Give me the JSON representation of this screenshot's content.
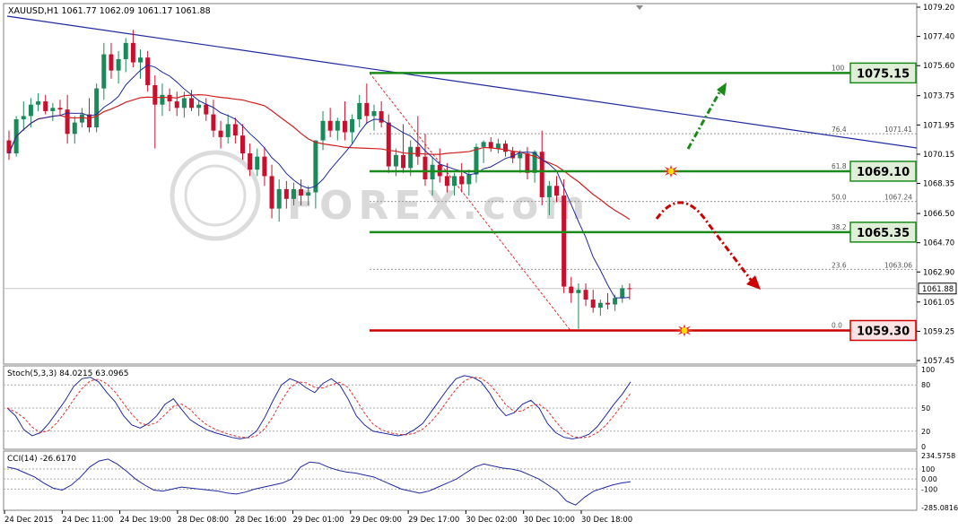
{
  "symbol_header": "XAUUSD,H1  1061.77 1062.09 1061.17 1061.88",
  "watermark": "FOREX.com",
  "price_axis": {
    "ticks": [
      "1079.20",
      "1077.40",
      "1075.60",
      "1073.75",
      "1071.95",
      "1070.15",
      "1068.35",
      "1066.50",
      "1064.70",
      "1062.90",
      "1061.05",
      "1059.25",
      "1057.45"
    ],
    "current_price": "1061.88",
    "range": [
      1057.45,
      1079.2
    ]
  },
  "time_axis": [
    "24 Dec 2015",
    "24 Dec 11:00",
    "24 Dec 19:00",
    "28 Dec 08:00",
    "28 Dec 16:00",
    "29 Dec 01:00",
    "29 Dec 09:00",
    "29 Dec 17:00",
    "30 Dec 02:00",
    "30 Dec 10:00",
    "30 Dec 18:00"
  ],
  "levels": [
    {
      "label": "1075.15",
      "price": 1075.15,
      "color": "#1a8a1a",
      "fib": "100"
    },
    {
      "label": "1069.10",
      "price": 1069.1,
      "color": "#1a8a1a",
      "fib": "61.8"
    },
    {
      "label": "1065.35",
      "price": 1065.35,
      "color": "#1a8a1a",
      "fib": "38.2"
    },
    {
      "label": "1059.30",
      "price": 1059.3,
      "color": "#cc0000",
      "fib": "0.0"
    }
  ],
  "fib_dotted": [
    {
      "fib": "76.4",
      "price": 1071.41,
      "price_label": "1071.41"
    },
    {
      "fib": "50.0",
      "price": 1067.24,
      "price_label": "1067.24"
    },
    {
      "fib": "23.6",
      "price": 1063.06,
      "price_label": "1063.06"
    }
  ],
  "stoch": {
    "label": "Stoch(5,3,3) 84.0215 63.0965",
    "ticks": [
      "100",
      "80",
      "50",
      "20",
      "0"
    ]
  },
  "cci": {
    "label": "CCI(14) -26.6170",
    "ticks": [
      "234.5758",
      "0.00",
      "-100",
      "-285.0816"
    ],
    "extra_tick": "100"
  },
  "colors": {
    "bull": "#1a8a5a",
    "bear": "#c8102e",
    "trend": "#1f2a9e",
    "ma_red": "#d02020",
    "ma_blue": "#1f2a9e",
    "up_arrow": "#1a8a1a",
    "down_arrow": "#cc0000"
  },
  "chart_data": {
    "type": "candlestick",
    "title": "XAUUSD,H1",
    "ylim": [
      1057.45,
      1079.2
    ],
    "candles": [
      [
        1071.0,
        1071.6,
        1069.8,
        1070.2
      ],
      [
        1070.2,
        1072.5,
        1070.0,
        1072.3
      ],
      [
        1072.3,
        1073.4,
        1071.6,
        1072.5
      ],
      [
        1072.5,
        1073.6,
        1071.8,
        1073.2
      ],
      [
        1073.2,
        1073.9,
        1072.8,
        1073.4
      ],
      [
        1073.4,
        1073.8,
        1072.6,
        1072.8
      ],
      [
        1072.8,
        1073.3,
        1072.2,
        1073.0
      ],
      [
        1073.0,
        1073.5,
        1072.5,
        1072.9
      ],
      [
        1072.9,
        1073.8,
        1070.8,
        1071.4
      ],
      [
        1071.4,
        1072.5,
        1070.8,
        1072.1
      ],
      [
        1072.1,
        1073.0,
        1071.8,
        1072.6
      ],
      [
        1072.6,
        1073.6,
        1071.5,
        1071.8
      ],
      [
        1071.8,
        1074.5,
        1071.5,
        1074.2
      ],
      [
        1074.2,
        1077.0,
        1073.5,
        1076.3
      ],
      [
        1076.3,
        1077.0,
        1074.8,
        1075.3
      ],
      [
        1075.3,
        1076.5,
        1074.5,
        1076.0
      ],
      [
        1076.0,
        1077.3,
        1075.2,
        1077.0
      ],
      [
        1077.0,
        1077.8,
        1075.5,
        1075.8
      ],
      [
        1075.8,
        1076.6,
        1074.8,
        1076.1
      ],
      [
        1076.1,
        1076.5,
        1074.0,
        1074.4
      ],
      [
        1074.4,
        1075.0,
        1070.5,
        1073.2
      ],
      [
        1073.2,
        1074.5,
        1072.5,
        1073.8
      ],
      [
        1073.8,
        1074.2,
        1072.8,
        1073.4
      ],
      [
        1073.4,
        1074.0,
        1072.5,
        1073.0
      ],
      [
        1073.0,
        1074.0,
        1072.4,
        1073.6
      ],
      [
        1073.6,
        1074.1,
        1072.8,
        1073.0
      ],
      [
        1073.0,
        1073.5,
        1072.5,
        1073.2
      ],
      [
        1073.2,
        1073.6,
        1072.2,
        1072.6
      ],
      [
        1072.6,
        1073.5,
        1071.2,
        1071.6
      ],
      [
        1071.6,
        1072.2,
        1070.5,
        1071.2
      ],
      [
        1071.2,
        1072.6,
        1070.8,
        1072.0
      ],
      [
        1072.0,
        1072.4,
        1070.8,
        1071.3
      ],
      [
        1071.3,
        1072.0,
        1069.8,
        1070.2
      ],
      [
        1070.2,
        1070.8,
        1068.8,
        1069.2
      ],
      [
        1069.2,
        1070.5,
        1068.8,
        1070.0
      ],
      [
        1070.0,
        1070.6,
        1068.2,
        1068.8
      ],
      [
        1068.8,
        1069.5,
        1066.2,
        1066.8
      ],
      [
        1066.8,
        1068.6,
        1066.0,
        1068.0
      ],
      [
        1068.0,
        1068.5,
        1066.8,
        1067.4
      ],
      [
        1067.4,
        1068.4,
        1067.0,
        1068.0
      ],
      [
        1068.0,
        1068.6,
        1067.0,
        1067.6
      ],
      [
        1067.6,
        1068.2,
        1067.0,
        1067.8
      ],
      [
        1067.8,
        1070.0,
        1066.8,
        1071.0
      ],
      [
        1071.0,
        1072.8,
        1070.4,
        1072.2
      ],
      [
        1072.2,
        1073.0,
        1071.2,
        1071.6
      ],
      [
        1071.6,
        1072.4,
        1071.0,
        1072.2
      ],
      [
        1072.2,
        1073.4,
        1071.0,
        1071.5
      ],
      [
        1071.5,
        1072.6,
        1070.8,
        1072.3
      ],
      [
        1072.3,
        1073.8,
        1071.8,
        1073.3
      ],
      [
        1073.3,
        1074.5,
        1072.0,
        1072.5
      ],
      [
        1072.5,
        1073.2,
        1071.6,
        1072.8
      ],
      [
        1072.8,
        1073.4,
        1071.8,
        1072.1
      ],
      [
        1072.1,
        1072.6,
        1069.0,
        1069.4
      ],
      [
        1069.4,
        1070.5,
        1068.8,
        1070.1
      ],
      [
        1070.1,
        1072.0,
        1069.0,
        1069.3
      ],
      [
        1069.3,
        1071.0,
        1068.8,
        1070.6
      ],
      [
        1070.6,
        1072.5,
        1069.5,
        1070.0
      ],
      [
        1070.0,
        1071.4,
        1068.2,
        1068.6
      ],
      [
        1068.6,
        1070.0,
        1067.6,
        1069.5
      ],
      [
        1069.5,
        1070.5,
        1068.4,
        1068.8
      ],
      [
        1068.8,
        1069.6,
        1067.8,
        1068.2
      ],
      [
        1068.2,
        1069.0,
        1067.6,
        1068.8
      ],
      [
        1068.8,
        1069.6,
        1067.8,
        1068.3
      ],
      [
        1068.3,
        1069.2,
        1067.6,
        1068.9
      ],
      [
        1068.9,
        1070.8,
        1068.4,
        1070.6
      ],
      [
        1070.6,
        1071.0,
        1069.6,
        1070.9
      ],
      [
        1070.9,
        1071.2,
        1070.3,
        1070.5
      ],
      [
        1070.5,
        1071.1,
        1070.2,
        1070.8
      ],
      [
        1070.8,
        1071.0,
        1070.0,
        1070.3
      ],
      [
        1070.3,
        1070.6,
        1069.6,
        1069.9
      ],
      [
        1069.9,
        1070.4,
        1069.0,
        1070.2
      ],
      [
        1070.2,
        1070.6,
        1068.6,
        1069.0
      ],
      [
        1069.0,
        1070.4,
        1068.4,
        1070.3
      ],
      [
        1070.3,
        1071.6,
        1067.0,
        1067.5
      ],
      [
        1067.5,
        1068.5,
        1066.4,
        1068.2
      ],
      [
        1068.2,
        1068.8,
        1067.2,
        1067.6
      ],
      [
        1067.6,
        1068.6,
        1061.6,
        1062.0
      ],
      [
        1062.0,
        1062.6,
        1061.0,
        1061.6
      ],
      [
        1061.6,
        1062.2,
        1059.4,
        1061.8
      ],
      [
        1061.8,
        1062.2,
        1060.8,
        1061.2
      ],
      [
        1061.2,
        1061.8,
        1060.4,
        1060.7
      ],
      [
        1060.7,
        1061.2,
        1060.2,
        1061.0
      ],
      [
        1061.0,
        1061.6,
        1060.6,
        1060.9
      ],
      [
        1060.9,
        1061.5,
        1060.5,
        1061.3
      ],
      [
        1061.3,
        1062.1,
        1061.0,
        1061.9
      ],
      [
        1061.9,
        1062.2,
        1061.2,
        1061.88
      ]
    ]
  }
}
